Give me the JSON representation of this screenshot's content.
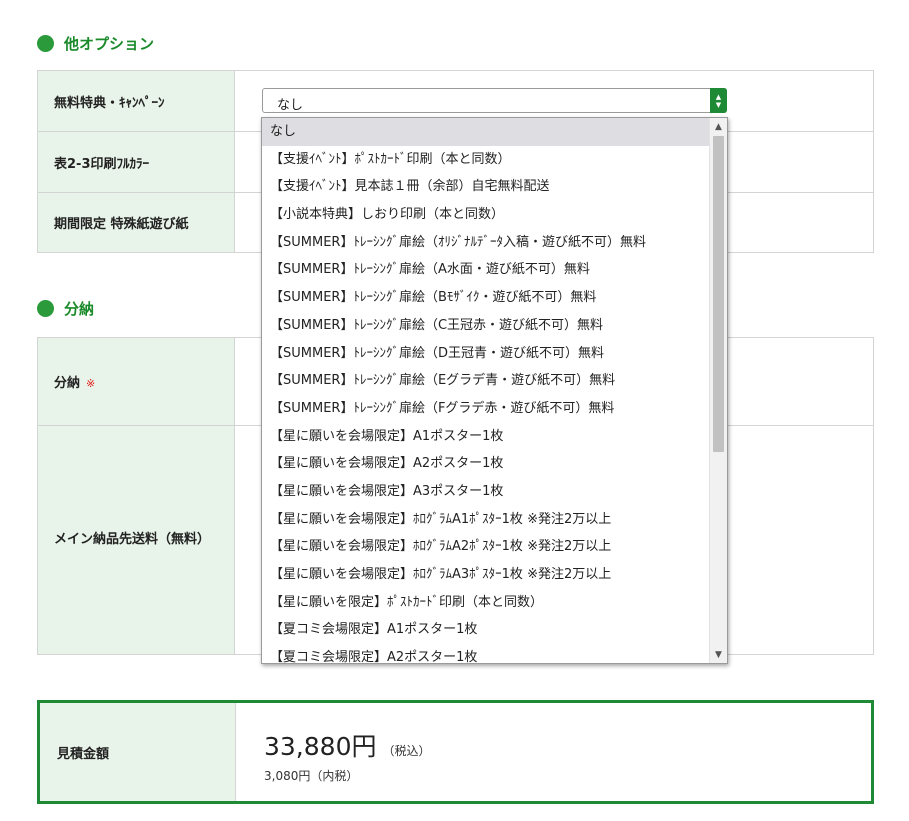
{
  "other_options": {
    "title": "他オプション",
    "rows": [
      {
        "label": "無料特典・ｷｬﾝﾍﾟｰﾝ"
      },
      {
        "label": "表2-3印刷ﾌﾙｶﾗｰ"
      },
      {
        "label": "期間限定 特殊紙遊び紙"
      }
    ],
    "select_value": "なし"
  },
  "dropdown": {
    "options": [
      "なし",
      "【支援ｲﾍﾞﾝﾄ】ﾎﾟｽﾄｶｰﾄﾞ印刷（本と同数）",
      "【支援ｲﾍﾞﾝﾄ】見本誌１冊（余部）自宅無料配送",
      "【小説本特典】しおり印刷（本と同数）",
      "【SUMMER】ﾄﾚｰｼﾝｸﾞ扉絵（ｵﾘｼﾞﾅﾙﾃﾞｰﾀ入稿・遊び紙不可）無料",
      "【SUMMER】ﾄﾚｰｼﾝｸﾞ扉絵（A水面・遊び紙不可）無料",
      "【SUMMER】ﾄﾚｰｼﾝｸﾞ扉絵（Bﾓｻﾞｲｸ・遊び紙不可）無料",
      "【SUMMER】ﾄﾚｰｼﾝｸﾞ扉絵（C王冠赤・遊び紙不可）無料",
      "【SUMMER】ﾄﾚｰｼﾝｸﾞ扉絵（D王冠青・遊び紙不可）無料",
      "【SUMMER】ﾄﾚｰｼﾝｸﾞ扉絵（Eグラデ青・遊び紙不可）無料",
      "【SUMMER】ﾄﾚｰｼﾝｸﾞ扉絵（Fグラデ赤・遊び紙不可）無料",
      "【星に願いを会場限定】A1ポスター1枚",
      "【星に願いを会場限定】A2ポスター1枚",
      "【星に願いを会場限定】A3ポスター1枚",
      "【星に願いを会場限定】ﾎﾛｸﾞﾗﾑA1ﾎﾟｽﾀｰ1枚 ※発注2万以上",
      "【星に願いを会場限定】ﾎﾛｸﾞﾗﾑA2ﾎﾟｽﾀｰ1枚 ※発注2万以上",
      "【星に願いを会場限定】ﾎﾛｸﾞﾗﾑA3ﾎﾟｽﾀｰ1枚 ※発注2万以上",
      "【星に願いを限定】ﾎﾟｽﾄｶｰﾄﾞ印刷（本と同数）",
      "【夏コミ会場限定】A1ポスター1枚",
      "【夏コミ会場限定】A2ポスター1枚"
    ]
  },
  "split_delivery": {
    "title": "分納",
    "rows": [
      {
        "label": "分納",
        "required_mark": "※"
      },
      {
        "label": "メイン納品先送料（無料）"
      }
    ]
  },
  "estimate": {
    "label": "見積金額",
    "total": "33,880円",
    "total_note": "（税込）",
    "tax": "3,080円（内税）"
  },
  "colors": {
    "accent_green": "#1f8a35",
    "header_bg": "#e8f3e9"
  }
}
